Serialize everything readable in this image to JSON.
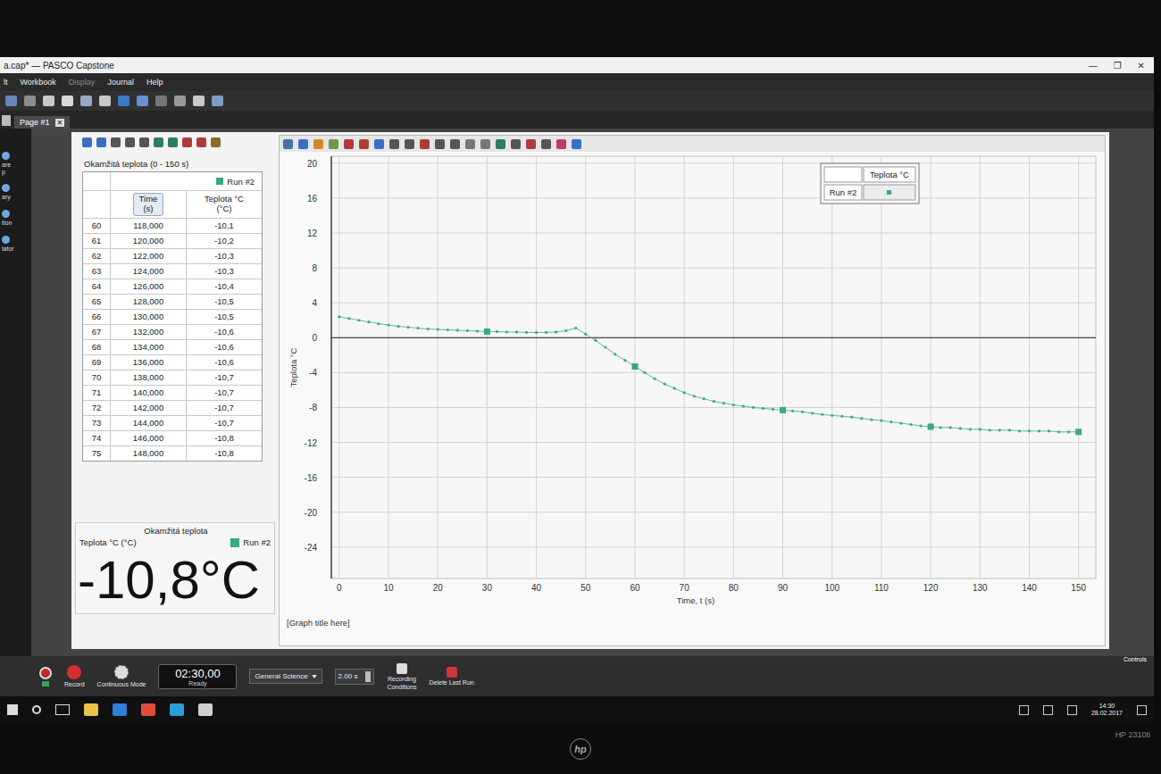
{
  "window": {
    "title": "a.cap* — PASCO Capstone",
    "controls": [
      "—",
      "❐",
      "✕"
    ]
  },
  "menu": [
    {
      "label": "lt",
      "disabled": false
    },
    {
      "label": "Workbook",
      "disabled": false
    },
    {
      "label": "Display",
      "disabled": true
    },
    {
      "label": "Journal",
      "disabled": false
    },
    {
      "label": "Help",
      "disabled": false
    }
  ],
  "page_tabs": [
    {
      "label": "Page #1",
      "selected": true,
      "close": "✕"
    }
  ],
  "sidebar": {
    "items": [
      {
        "lines": [
          "are",
          "p"
        ]
      },
      {
        "lines": [
          "ary"
        ]
      },
      {
        "lines": [
          "tion"
        ]
      },
      {
        "lines": [
          "lator"
        ]
      }
    ]
  },
  "table": {
    "title": "Okamžitá teplota (0 - 150 s)",
    "run": "Run #2",
    "color": "#37a88a",
    "columns": [
      {
        "lines": [
          "Time",
          "(s)"
        ],
        "selected": true
      },
      {
        "lines": [
          "Teplota °C",
          "(°C)"
        ],
        "selected": false
      }
    ],
    "rows": [
      {
        "n": "60",
        "time": "118,000",
        "temp": "-10,1"
      },
      {
        "n": "61",
        "time": "120,000",
        "temp": "-10,2"
      },
      {
        "n": "62",
        "time": "122,000",
        "temp": "-10,3"
      },
      {
        "n": "63",
        "time": "124,000",
        "temp": "-10,3"
      },
      {
        "n": "64",
        "time": "126,000",
        "temp": "-10,4"
      },
      {
        "n": "65",
        "time": "128,000",
        "temp": "-10,5"
      },
      {
        "n": "66",
        "time": "130,000",
        "temp": "-10,5"
      },
      {
        "n": "67",
        "time": "132,000",
        "temp": "-10,6"
      },
      {
        "n": "68",
        "time": "134,000",
        "temp": "-10,6"
      },
      {
        "n": "69",
        "time": "136,000",
        "temp": "-10,6"
      },
      {
        "n": "70",
        "time": "138,000",
        "temp": "-10,7"
      },
      {
        "n": "71",
        "time": "140,000",
        "temp": "-10,7"
      },
      {
        "n": "72",
        "time": "142,000",
        "temp": "-10,7"
      },
      {
        "n": "73",
        "time": "144,000",
        "temp": "-10,7"
      },
      {
        "n": "74",
        "time": "146,000",
        "temp": "-10,8"
      },
      {
        "n": "75",
        "time": "148,000",
        "temp": "-10,8"
      }
    ]
  },
  "digits": {
    "title": "Okamžitá teplota",
    "label": "Teplota °C (°C)",
    "run": "Run #2",
    "value": "-10,8°C",
    "color": "#37a88a"
  },
  "graph": {
    "legend_header": "Teplota °C",
    "legend_run": "Run #2",
    "y_title": "Teplota °C",
    "x_title": "Time, t (s)",
    "title": "[Graph title here]",
    "y_ticks": [
      "20",
      "16",
      "12",
      "8",
      "4",
      "0",
      "-4",
      "-8",
      "-12",
      "-16",
      "-20",
      "-24"
    ],
    "x_ticks": [
      "0",
      "10",
      "20",
      "30",
      "40",
      "50",
      "60",
      "70",
      "80",
      "90",
      "100",
      "110",
      "120",
      "130",
      "140",
      "150"
    ],
    "color": "#37a88a",
    "x_start": 0,
    "x_step": 2,
    "values": [
      2.4,
      2.2,
      2.0,
      1.8,
      1.6,
      1.45,
      1.3,
      1.2,
      1.1,
      1.0,
      0.95,
      0.9,
      0.85,
      0.8,
      0.75,
      0.7,
      0.7,
      0.65,
      0.65,
      0.6,
      0.6,
      0.6,
      0.65,
      0.8,
      1.1,
      0.4,
      -0.3,
      -1.1,
      -1.9,
      -2.6,
      -3.3,
      -4.0,
      -4.7,
      -5.3,
      -5.8,
      -6.3,
      -6.7,
      -7.0,
      -7.3,
      -7.5,
      -7.7,
      -7.85,
      -8.0,
      -8.1,
      -8.2,
      -8.3,
      -8.4,
      -8.5,
      -8.65,
      -8.8,
      -8.9,
      -9.0,
      -9.1,
      -9.25,
      -9.4,
      -9.5,
      -9.65,
      -9.8,
      -9.95,
      -10.1,
      -10.2,
      -10.3,
      -10.3,
      -10.4,
      -10.5,
      -10.5,
      -10.6,
      -10.6,
      -10.6,
      -10.7,
      -10.7,
      -10.7,
      -10.7,
      -10.8,
      -10.8,
      -10.8
    ]
  },
  "controls": {
    "label": "Controls",
    "record": "Record",
    "mode": "Continuous Mode",
    "timer": "02:30,00",
    "timer_state": "Ready",
    "template": "General Science",
    "rate": "2.00 s",
    "conditions": [
      "Recording",
      "Conditions"
    ],
    "delete": "Delete Last Run"
  },
  "taskbar": {
    "time": "14:30",
    "date": "28.02.2017"
  },
  "monitor": {
    "logo": "hp",
    "model": "HP 2310ti"
  }
}
